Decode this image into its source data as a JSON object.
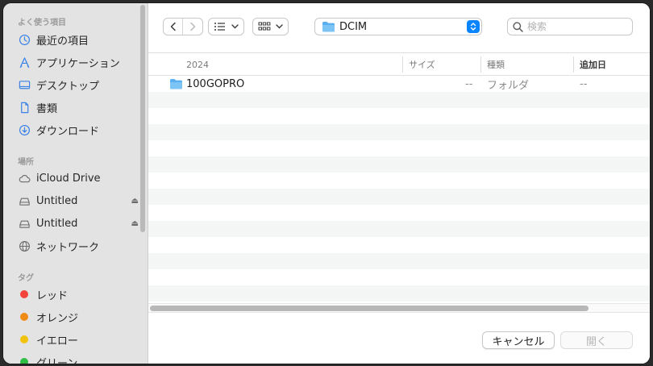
{
  "sidebar": {
    "favorites_title": "よく使う項目",
    "favorites": [
      {
        "label": "最近の項目",
        "icon": "clock-icon"
      },
      {
        "label": "アプリケーション",
        "icon": "applications-icon"
      },
      {
        "label": "デスクトップ",
        "icon": "desktop-icon"
      },
      {
        "label": "書類",
        "icon": "document-icon"
      },
      {
        "label": "ダウンロード",
        "icon": "download-icon"
      }
    ],
    "locations_title": "場所",
    "locations": [
      {
        "label": "iCloud Drive",
        "icon": "cloud-icon"
      },
      {
        "label": "Untitled",
        "icon": "drive-icon",
        "eject": "⏏"
      },
      {
        "label": "Untitled",
        "icon": "drive-icon",
        "eject": "⏏"
      },
      {
        "label": "ネットワーク",
        "icon": "network-icon"
      }
    ],
    "tags_title": "タグ",
    "tags": [
      {
        "label": "レッド",
        "color": "#f2443a"
      },
      {
        "label": "オレンジ",
        "color": "#f08a17"
      },
      {
        "label": "イエロー",
        "color": "#f2c30d"
      },
      {
        "label": "グリーン",
        "color": "#2fbd46"
      }
    ]
  },
  "toolbar": {
    "path": "DCIM",
    "search_placeholder": "検索",
    "accent": "#0a84ff"
  },
  "list": {
    "headers": {
      "name": "2024",
      "size": "サイズ",
      "kind": "種類",
      "added": "追加日"
    },
    "rows": [
      {
        "name": "100GOPRO",
        "size": "--",
        "kind": "フォルダ",
        "added": "--"
      }
    ]
  },
  "buttons": {
    "cancel": "キャンセル",
    "open": "開く"
  }
}
